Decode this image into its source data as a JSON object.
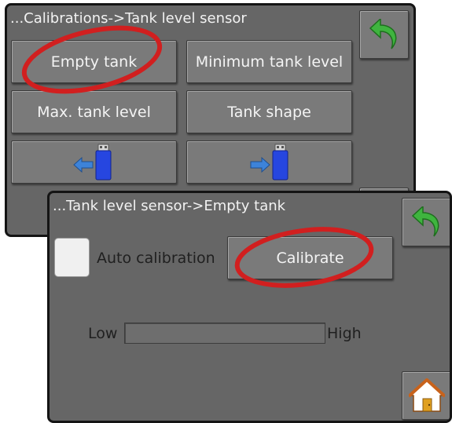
{
  "colors": {
    "panel_background": "#666666",
    "button_background": "#7a7a7a",
    "back_arrow": "#3fb43f",
    "usb_blue": "#2646e0",
    "arrow_blue": "#3d83d9",
    "annotation_red": "#d11f1f"
  },
  "screen_calibrations": {
    "title": "...Calibrations->Tank level sensor",
    "back_icon": "green-back-arrow-icon",
    "buttons": {
      "empty_tank": "Empty tank",
      "minimum_tank_level": "Minimum tank level",
      "max_tank_level": "Max. tank level",
      "tank_shape": "Tank shape"
    },
    "usb_import_icon": "usb-import-icon",
    "usb_export_icon": "usb-export-icon"
  },
  "screen_empty_tank": {
    "title": "...Tank level sensor->Empty tank",
    "back_icon": "green-back-arrow-icon",
    "auto_calibration_label": "Auto calibration",
    "calibrate_button": "Calibrate",
    "level_bar": {
      "low_label": "Low",
      "high_label": "High",
      "fill_fraction": 0
    },
    "home_icon": "home-icon"
  },
  "annotations": {
    "ellipse_1": "red-circle-around-empty-tank",
    "ellipse_2": "red-circle-around-calibrate"
  }
}
